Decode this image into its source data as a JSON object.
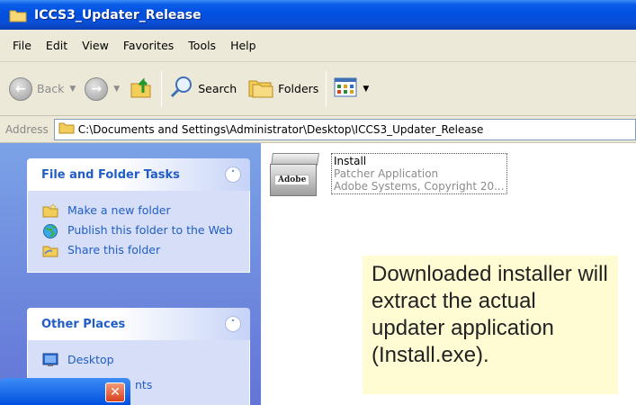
{
  "window": {
    "title": "ICCS3_Updater_Release"
  },
  "menubar": {
    "items": [
      "File",
      "Edit",
      "View",
      "Favorites",
      "Tools",
      "Help"
    ]
  },
  "toolbar": {
    "back_label": "Back",
    "search_label": "Search",
    "folders_label": "Folders"
  },
  "address": {
    "label": "Address",
    "path": "C:\\Documents and Settings\\Administrator\\Desktop\\ICCS3_Updater_Release"
  },
  "sidebar": {
    "file_tasks": {
      "title": "File and Folder Tasks",
      "items": [
        "Make a new folder",
        "Publish this folder to the Web",
        "Share this folder"
      ]
    },
    "other_places": {
      "title": "Other Places",
      "items": [
        "Desktop",
        "nts"
      ]
    }
  },
  "file": {
    "name": "Install",
    "description": "Patcher Application",
    "company": "Adobe Systems, Copyright 20...",
    "icon_label": "Adobe"
  },
  "callout": {
    "text": "Downloaded installer will extract the actual updater application (Install.exe)."
  },
  "colors": {
    "title_bar": "#0050e0",
    "sidebar_bg": "#6b8ee0",
    "callout_bg": "#fffbd2",
    "link": "#215dc6"
  }
}
